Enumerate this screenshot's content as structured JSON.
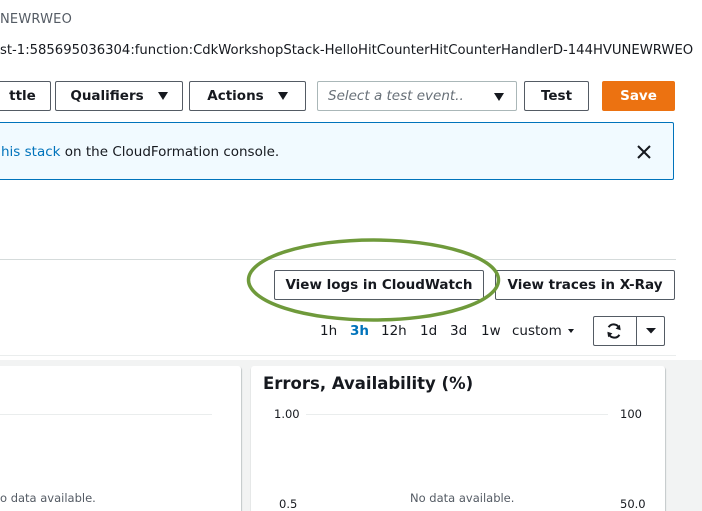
{
  "header": {
    "function_name_fragment": "NEWRWEO",
    "arn": "st-1:585695036304:function:CdkWorkshopStack-HelloHitCounterHitCounterHandlerD-144HVUNEWRWEO"
  },
  "toolbar": {
    "throttle_label": "ttle",
    "qualifiers_label": "Qualifiers",
    "actions_label": "Actions",
    "test_event_placeholder": "Select a test event..",
    "test_label": "Test",
    "save_label": "Save"
  },
  "banner": {
    "link_text": "his stack",
    "text": " on the CloudFormation console."
  },
  "monitoring": {
    "view_logs_label": "View logs in CloudWatch",
    "view_traces_label": "View traces in X-Ray",
    "time_ranges": [
      "1h",
      "3h",
      "12h",
      "1d",
      "3d",
      "1w"
    ],
    "active_range": "3h",
    "custom_label": "custom"
  },
  "charts": {
    "left": {
      "no_data": "o data available."
    },
    "right": {
      "title": "Errors, Availability (%)",
      "left_ticks": [
        "1.00",
        "0.5"
      ],
      "right_ticks": [
        "100",
        "50.0"
      ],
      "no_data": "No data available."
    }
  },
  "colors": {
    "primary_button": "#ec7211",
    "link": "#0073bb",
    "highlight_ring": "#6f9a3b"
  }
}
